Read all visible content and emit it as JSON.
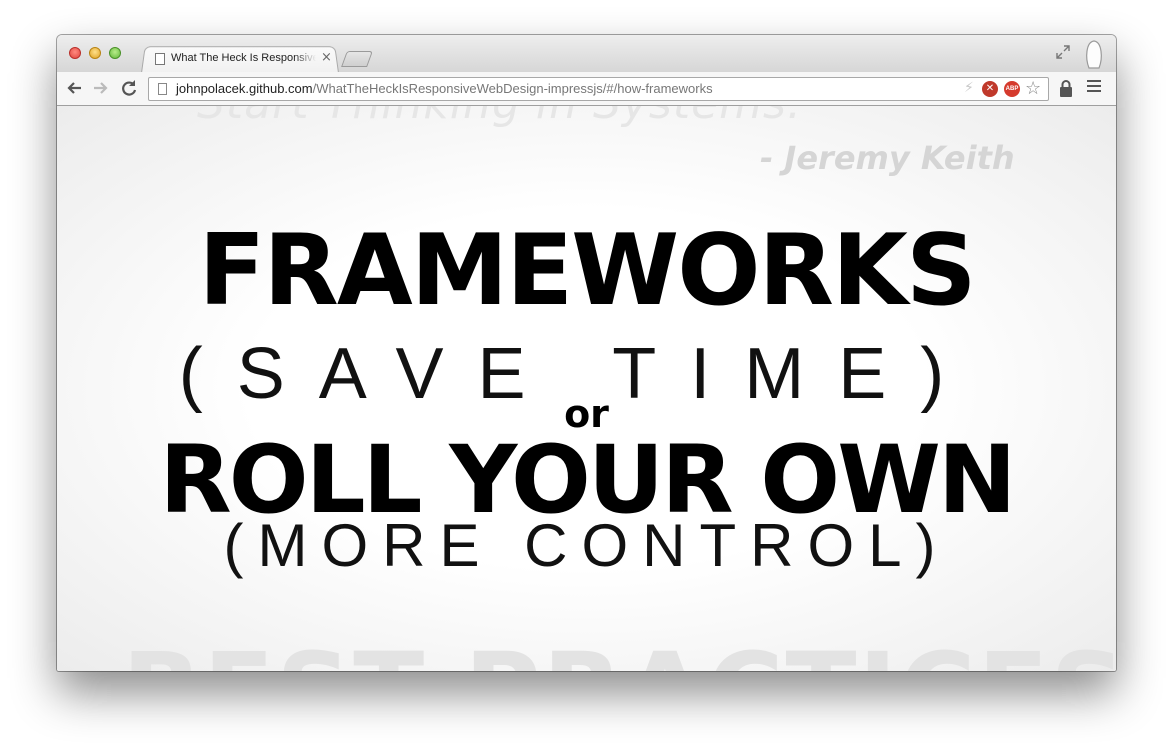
{
  "browser": {
    "tab": {
      "title": "What The Heck Is Responsive Web Design",
      "close": "×"
    },
    "url": {
      "host": "johnpolacek.github.com",
      "path": "/WhatTheHeckIsResponsiveWebDesign-impressjs/#/how-frameworks"
    },
    "extensions": {
      "abp_label": "ABP"
    }
  },
  "slide": {
    "ghost_quote": "Start Thinking in Systems.",
    "ghost_attribution": "- Jeremy Keith",
    "line1": "FRAMEWORKS",
    "line2": "(SAVE TIME)",
    "connector": "or",
    "line3": "ROLL YOUR OWN",
    "line4": "(MORE CONTROL)",
    "ghost_next": "BEST PRACTICES"
  }
}
